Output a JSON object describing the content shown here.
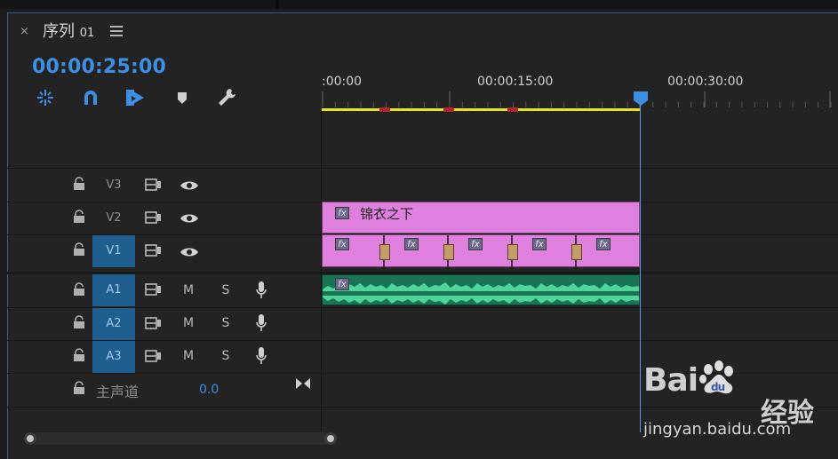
{
  "tab": {
    "close_glyph": "×",
    "title": "序列",
    "title_num": "01"
  },
  "timecode": "00:00:25:00",
  "tools": [
    {
      "name": "insert-sequence-nest-icon"
    },
    {
      "name": "snap-magnet-icon"
    },
    {
      "name": "linked-selection-icon"
    },
    {
      "name": "add-marker-icon"
    },
    {
      "name": "timeline-settings-wrench-icon"
    }
  ],
  "ruler": {
    "labels": [
      ":00:00",
      "00:00:15:00",
      "00:00:30:00"
    ]
  },
  "tracks": {
    "video": [
      {
        "label": "V3",
        "active": false
      },
      {
        "label": "V2",
        "active": false
      },
      {
        "label": "V1",
        "active": true
      }
    ],
    "audio": [
      {
        "label": "A1",
        "m": "M",
        "s": "S"
      },
      {
        "label": "A2",
        "m": "M",
        "s": "S"
      },
      {
        "label": "A3",
        "m": "M",
        "s": "S"
      }
    ],
    "master": {
      "label": "主声道",
      "value": "0.0"
    }
  },
  "clips": {
    "title_clip_label": "锦衣之下",
    "fx_label": "fx"
  },
  "colors": {
    "accent": "#3d8fe6",
    "video_clip": "#e080de",
    "audio_clip": "#187453",
    "work_area": "#e6e21c",
    "active_track": "#1f5f8f"
  },
  "watermark": {
    "logo_bai": "Bai",
    "logo_du": "du",
    "cn": "经验",
    "url": "jingyan.baidu.com"
  }
}
